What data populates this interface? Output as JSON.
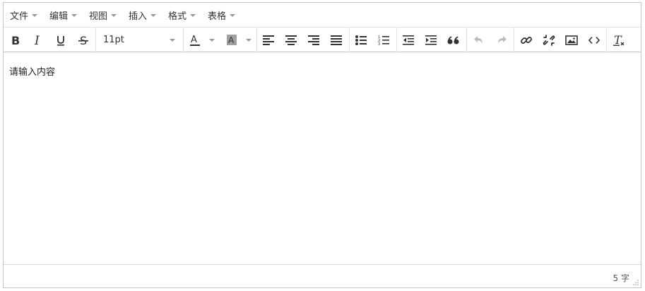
{
  "menubar": {
    "items": [
      {
        "label": "文件"
      },
      {
        "label": "编辑"
      },
      {
        "label": "视图"
      },
      {
        "label": "插入"
      },
      {
        "label": "格式"
      },
      {
        "label": "表格"
      }
    ]
  },
  "toolbar": {
    "font_size": "11pt",
    "buttons": [
      "bold-icon",
      "italic-icon",
      "underline-icon",
      "strikethrough-icon",
      "text-color-icon",
      "background-color-icon",
      "align-left-icon",
      "align-center-icon",
      "align-right-icon",
      "align-justify-icon",
      "bullet-list-icon",
      "numbered-list-icon",
      "outdent-icon",
      "indent-icon",
      "blockquote-icon",
      "undo-icon",
      "redo-icon",
      "link-icon",
      "unlink-icon",
      "image-icon",
      "code-icon",
      "clear-format-icon"
    ]
  },
  "content": {
    "text": "请输入内容"
  },
  "status": {
    "word_count": "5 字"
  },
  "colors": {
    "border": "#c5c5c5",
    "icon": "#333333",
    "disabled_icon": "#bbbbbb"
  }
}
